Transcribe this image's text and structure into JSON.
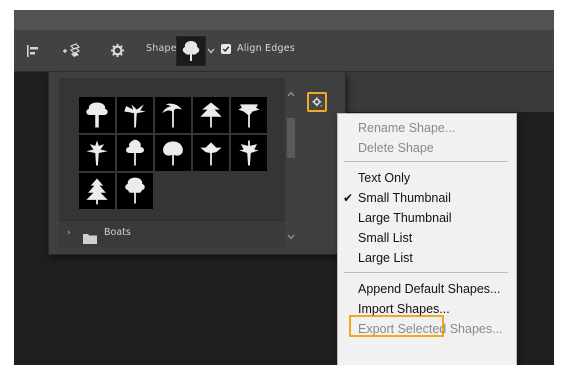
{
  "colors": {
    "accent_highlight": "#f5a623",
    "workspace_bg": "#201f1f",
    "options_bar_bg": "#424242",
    "menu_bg": "#f1f1f1"
  },
  "options_bar": {
    "align_icon": "align-left-icon",
    "transform_icon": "path-arrangement-icon",
    "settings_icon": "gear-icon",
    "shape_label": "Shape:",
    "shape_preview_icon": "tree-shape-icon",
    "shape_dropdown_icon": "chevron-down-icon",
    "align_edges_checked": true,
    "align_edges_label": "Align Edges"
  },
  "shape_picker": {
    "thumbnails": [
      "tree-1-icon",
      "tree-2-icon",
      "palm-tree-icon",
      "tree-4-icon",
      "tree-5-icon",
      "tree-6-icon",
      "tree-7-icon",
      "tree-8-icon",
      "tree-9-icon",
      "tree-10-icon",
      "tree-11-icon",
      "tree-12-icon"
    ],
    "folder": {
      "label": "Boats",
      "expanded": false
    },
    "settings_button_icon": "gear-icon"
  },
  "context_menu": {
    "items": [
      {
        "label": "Rename Shape...",
        "enabled": false,
        "checked": false
      },
      {
        "label": "Delete Shape",
        "enabled": false,
        "checked": false
      },
      {
        "label": "Text Only",
        "enabled": true,
        "checked": false
      },
      {
        "label": "Small Thumbnail",
        "enabled": true,
        "checked": true
      },
      {
        "label": "Large Thumbnail",
        "enabled": true,
        "checked": false
      },
      {
        "label": "Small List",
        "enabled": true,
        "checked": false
      },
      {
        "label": "Large List",
        "enabled": true,
        "checked": false
      },
      {
        "label": "Append Default Shapes...",
        "enabled": true,
        "checked": false
      },
      {
        "label": "Import Shapes...",
        "enabled": true,
        "checked": false,
        "highlighted": true
      },
      {
        "label": "Export Selected Shapes...",
        "enabled": false,
        "checked": false
      }
    ]
  }
}
